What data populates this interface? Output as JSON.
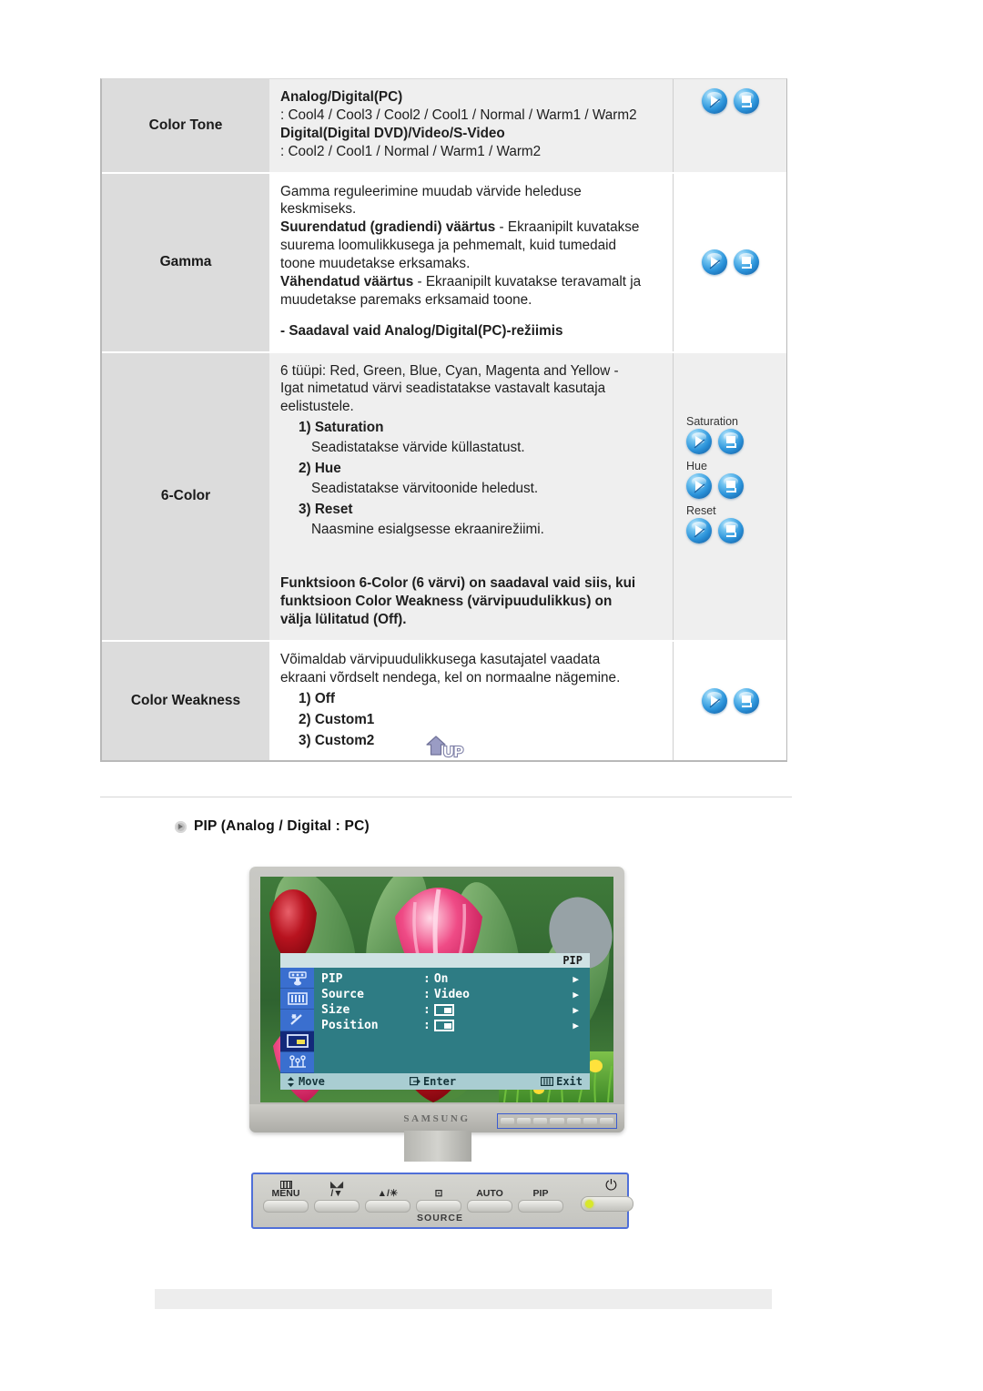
{
  "table": {
    "rows": [
      {
        "label": "Color Tone",
        "tint": "gray",
        "lines": [
          {
            "text": "Analog/Digital(PC)",
            "bold": true
          },
          {
            "text": ": Cool4 / Cool3 / Cool2 / Cool1 / Normal / Warm1 / Warm2",
            "bold": false
          },
          {
            "text": "Digital(Digital DVD)/Video/S-Video",
            "bold": true
          },
          {
            "text": ": Cool2 / Cool1 / Normal / Warm1 / Warm2",
            "bold": false
          }
        ],
        "icon_groups": [
          {
            "label": "",
            "icons": [
              "play-icon",
              "enter-icon"
            ]
          }
        ]
      },
      {
        "label": "Gamma",
        "tint": "white",
        "lines": [
          {
            "text": "Gamma reguleerimine muudab värvide heleduse",
            "bold": false
          },
          {
            "text": "keskmiseks.",
            "bold": false
          },
          {
            "text": "Suurendatud (gradiendi) väärtus",
            "bold": true,
            "tail": " - Ekraanipilt kuvatakse"
          },
          {
            "text": "suurema loomulikkusega ja pehmemalt, kuid tumedaid",
            "bold": false
          },
          {
            "text": "toone muudetakse erksamaks.",
            "bold": false
          },
          {
            "text": "Vähendatud väärtus",
            "bold": true,
            "tail": " - Ekraanipilt kuvatakse teravamalt ja"
          },
          {
            "text": "muudetakse paremaks erksamaid toone.",
            "bold": false
          },
          {
            "text": "",
            "bold": false
          },
          {
            "text": "- Saadaval vaid Analog/Digital(PC)-režiimis",
            "bold": true
          }
        ],
        "icon_groups": [
          {
            "label": "",
            "icons": [
              "play-icon",
              "enter-icon"
            ]
          }
        ]
      },
      {
        "label": "6-Color",
        "tint": "gray",
        "lines": [
          {
            "text": "6 tüüpi: Red, Green, Blue, Cyan, Magenta and Yellow -",
            "bold": false
          },
          {
            "text": "Igat nimetatud värvi seadistatakse vastavalt kasutaja",
            "bold": false
          },
          {
            "text": "eelistustele.",
            "bold": false
          },
          {
            "text": "1) Saturation",
            "bold": true,
            "indent": 1
          },
          {
            "text": "Seadistatakse värvide küllastatust.",
            "bold": false,
            "indent": 2
          },
          {
            "text": "2) Hue",
            "bold": true,
            "indent": 1
          },
          {
            "text": "Seadistatakse värvitoonide heledust.",
            "bold": false,
            "indent": 2
          },
          {
            "text": "3) Reset",
            "bold": true,
            "indent": 1
          },
          {
            "text": "Naasmine esialgsesse ekraanirežiimi.",
            "bold": false,
            "indent": 2
          },
          {
            "text": "",
            "bold": false
          },
          {
            "text": "",
            "bold": false
          },
          {
            "text": "Funktsioon 6-Color (6 värvi) on saadaval vaid siis, kui",
            "bold": true
          },
          {
            "text": "funktsioon Color Weakness (värvipuudulikkus) on",
            "bold": true
          },
          {
            "text": "välja lülitatud (Off).",
            "bold": true
          }
        ],
        "icon_groups": [
          {
            "label": "Saturation",
            "icons": [
              "play-icon",
              "enter-icon"
            ]
          },
          {
            "label": "Hue",
            "icons": [
              "play-icon",
              "enter-icon"
            ]
          },
          {
            "label": "Reset",
            "icons": [
              "play-icon",
              "enter-icon"
            ]
          }
        ]
      },
      {
        "label": "Color Weakness",
        "tint": "white",
        "lines": [
          {
            "text": "Võimaldab värvipuudulikkusega kasutajatel vaadata",
            "bold": false
          },
          {
            "text": "ekraani võrdselt nendega, kel on normaalne nägemine.",
            "bold": false
          },
          {
            "text": "1) Off",
            "bold": true,
            "indent": 1
          },
          {
            "text": "2) Custom1",
            "bold": true,
            "indent": 1
          },
          {
            "text": "3) Custom2",
            "bold": true,
            "indent": 1
          }
        ],
        "icon_groups": [
          {
            "label": "",
            "icons": [
              "play-icon",
              "enter-icon"
            ]
          }
        ]
      }
    ]
  },
  "up_button": {
    "label": "UP",
    "icon": "up-arrow-icon"
  },
  "pip_section": {
    "marker_icon": "bullet-arrow-icon",
    "heading": "PIP (Analog / Digital : PC)"
  },
  "monitor": {
    "brand": "SAMSUNG",
    "osd": {
      "title": "PIP",
      "side_icons": [
        {
          "name": "brightness-contrast-icon",
          "selected": false
        },
        {
          "name": "color-bars-icon",
          "selected": false
        },
        {
          "name": "image-wand-icon",
          "selected": false
        },
        {
          "name": "pip-icon",
          "selected": true
        },
        {
          "name": "setup-icon",
          "selected": false
        }
      ],
      "items": [
        {
          "name": "PIP",
          "value": "On",
          "value_type": "text",
          "arrow": "▶"
        },
        {
          "name": "Source",
          "value": "Video",
          "value_type": "text",
          "arrow": "▶"
        },
        {
          "name": "Size",
          "value": "",
          "value_type": "box",
          "arrow": "▶"
        },
        {
          "name": "Position",
          "value": "",
          "value_type": "box",
          "arrow": "▶"
        }
      ],
      "footer": {
        "move": "Move",
        "enter": "Enter",
        "exit": "Exit"
      }
    }
  },
  "control_panel": {
    "buttons": [
      {
        "glyph": "menu-icon",
        "label": "MENU"
      },
      {
        "glyph": "",
        "label": "/▼"
      },
      {
        "glyph": "",
        "label": "▲/☀"
      },
      {
        "glyph": "",
        "label": "⊡"
      },
      {
        "glyph": "",
        "label": "AUTO"
      },
      {
        "glyph": "",
        "label": "PIP"
      }
    ],
    "power_label": "⏻",
    "source_label": "SOURCE"
  },
  "colors": {
    "label_bg": "#dcdcdc",
    "row_tint": "#efefef",
    "icon_blue": "#2b93da",
    "osd_teal": "#2e7c84",
    "osd_blue": "#3a6fcf",
    "highlight_blue": "#4f6fd8"
  }
}
